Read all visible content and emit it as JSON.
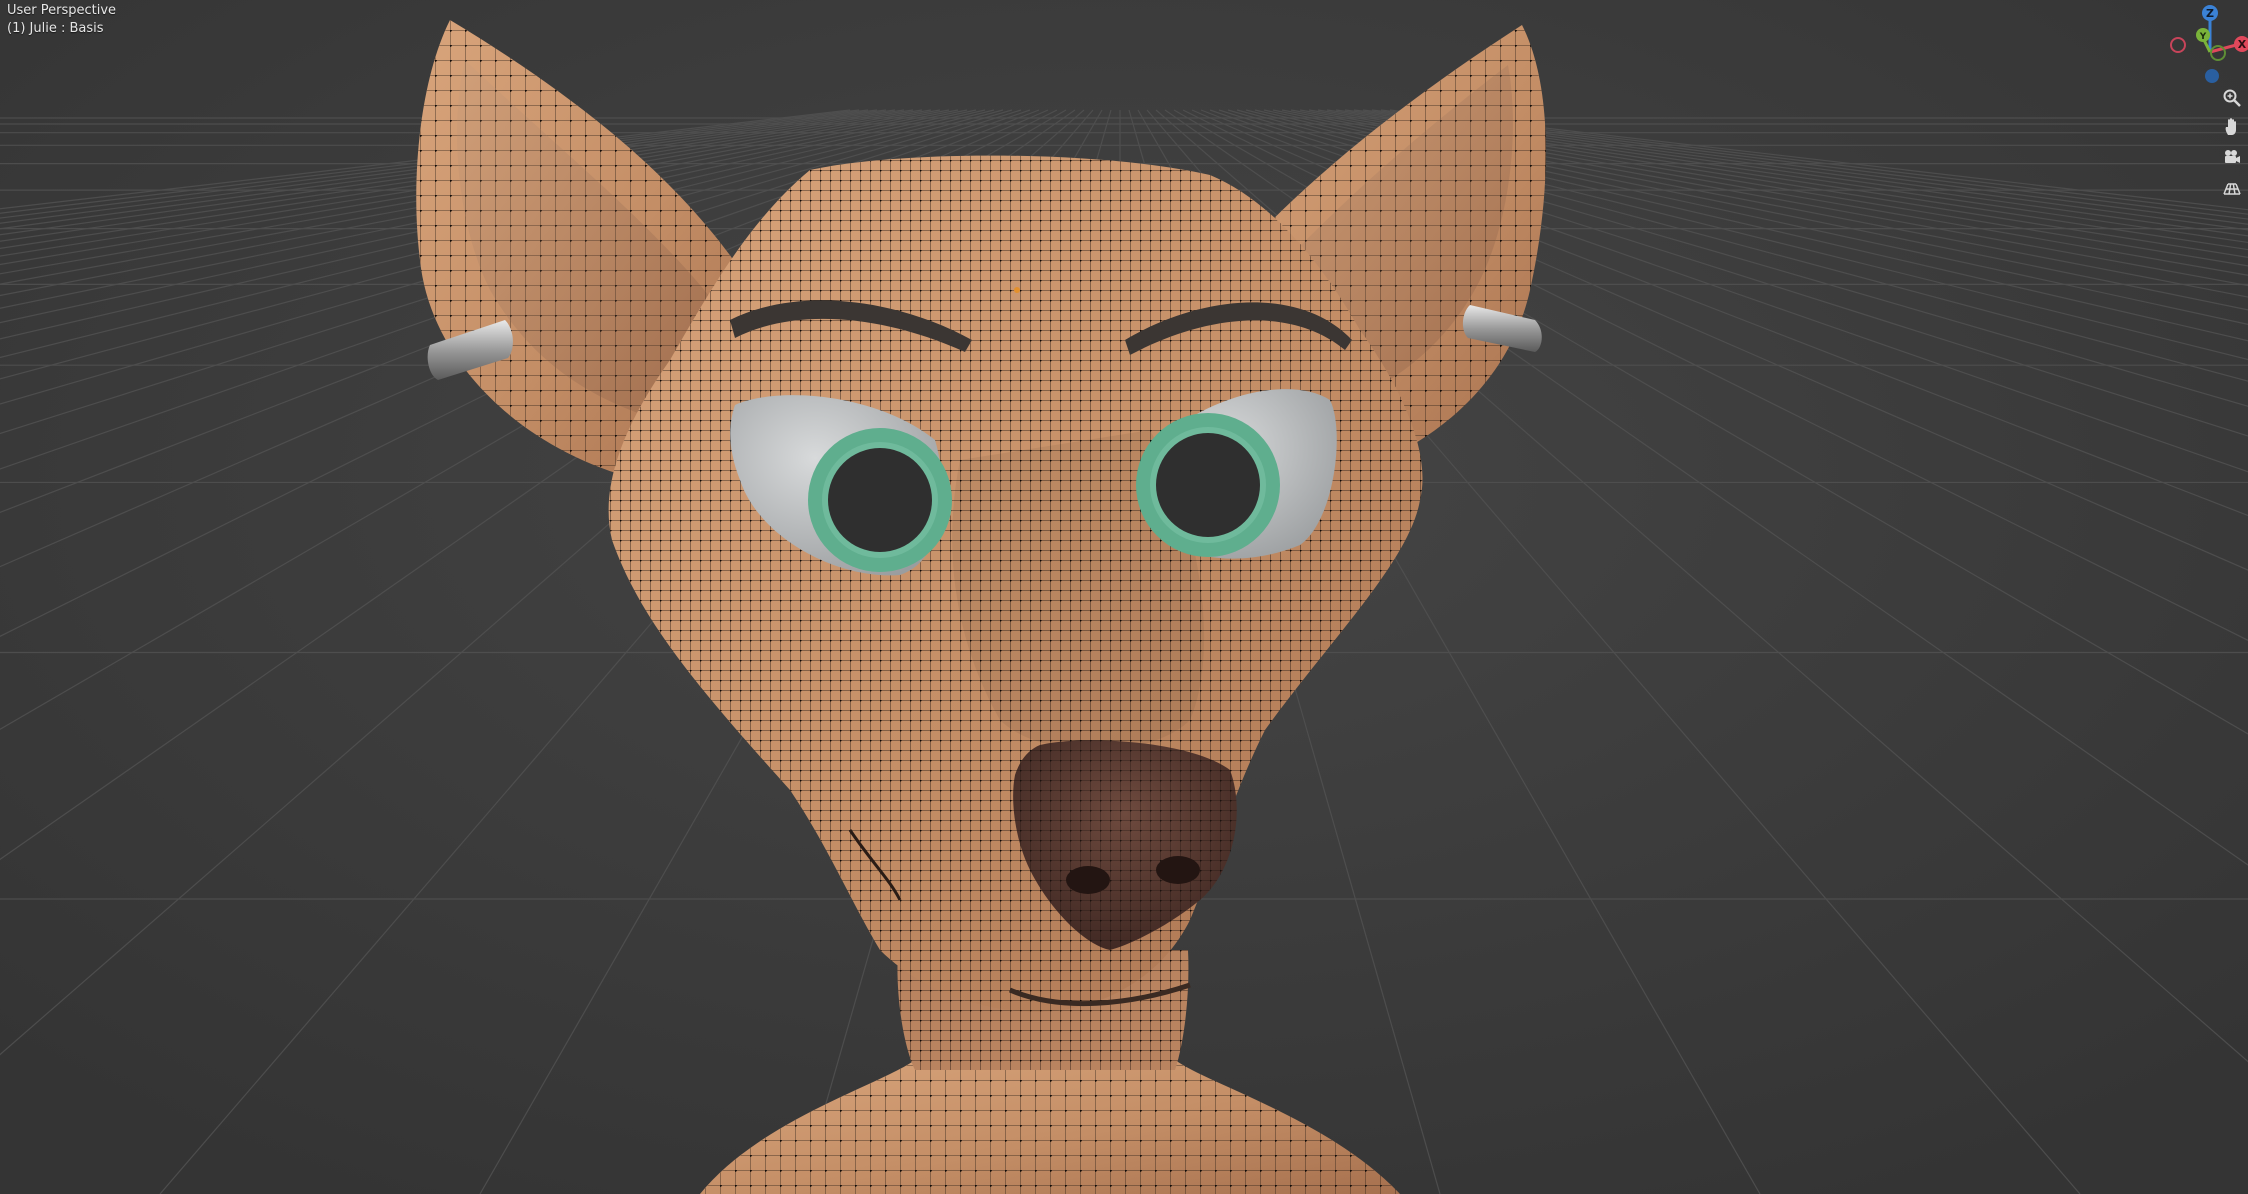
{
  "viewport": {
    "view_name": "User Perspective",
    "object_info": "(1) Julie : Basis"
  },
  "gizmo": {
    "z_label": "Z",
    "y_label": "Y",
    "x_label": "X",
    "colors": {
      "x": "#e0485b",
      "y": "#7ab33a",
      "z": "#3b82d6"
    }
  },
  "nav_buttons": [
    {
      "icon": "zoom-icon"
    },
    {
      "icon": "pan-hand-icon"
    },
    {
      "icon": "camera-icon"
    },
    {
      "icon": "grid-icon"
    }
  ],
  "scene": {
    "skin_color": "#c9936a",
    "wire_color": "#1b1410",
    "iris_color": "#5fae8e",
    "background": "#3c3c3c"
  }
}
